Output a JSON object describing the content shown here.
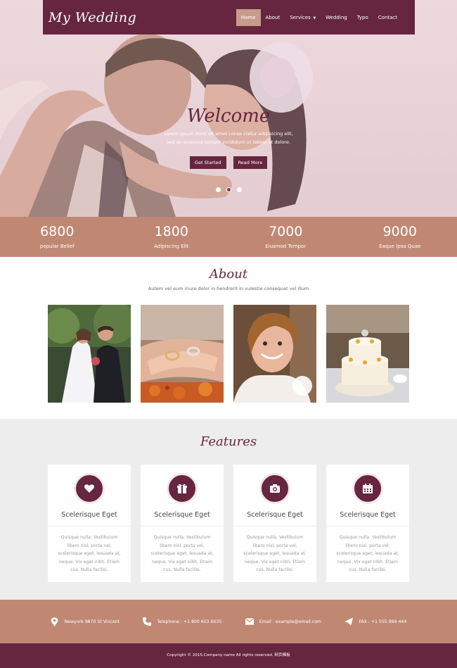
{
  "brand": {
    "logo": "My Wedding",
    "accent": "#66263f",
    "secondary": "#c08873"
  },
  "nav": {
    "items": [
      {
        "label": "Home",
        "active": true
      },
      {
        "label": "About"
      },
      {
        "label": "Services"
      },
      {
        "label": "Wedding"
      },
      {
        "label": "Typo"
      },
      {
        "label": "Contact"
      }
    ]
  },
  "hero": {
    "title": "Welcome",
    "text": "Lorem ipsum dolor sit amet conse ctetur adipisicing elit, sed do eiusmod tempor incididunt ut labore et dolore.",
    "primary_button": "Get Started",
    "secondary_button": "Read More",
    "slides": 3,
    "active_slide": 2
  },
  "stats": [
    {
      "value": "6800",
      "label": "popular Belief"
    },
    {
      "value": "1800",
      "label": "Adipiscing Elit"
    },
    {
      "value": "7000",
      "label": "Eiusmod Tempor"
    },
    {
      "value": "9000",
      "label": "Eaque Ipsa Quae"
    }
  ],
  "about": {
    "title": "About",
    "subtitle": "Autem vel eum iriure dolor in hendrerit in vulestie consequat vel illum"
  },
  "features": {
    "title": "Features",
    "cards": [
      {
        "icon": "heart-icon",
        "title": "Scelerisque Eget",
        "text": "Quisque nulla. Vestibulum libero nisl, porta vel, scelerisque eget, lesuada at, neque. Vix eget nibh. Etiam cus. Nulla facilisi."
      },
      {
        "icon": "gift-icon",
        "title": "Scelerisque Eget",
        "text": "Quisque nulla. Vestibulum libero nisl, porta vel, scelerisque eget, lesuada at, neque. Vix eget nibh. Etiam cus. Nulla facilisi."
      },
      {
        "icon": "camera-icon",
        "title": "Scelerisque Eget",
        "text": "Quisque nulla. Vestibulum libero nisl, porta vel, scelerisque eget, lesuada at, neque. Vix eget nibh. Etiam cus. Nulla facilisi."
      },
      {
        "icon": "calendar-icon",
        "title": "Scelerisque Eget",
        "text": "Quisque nulla. Vestibulum libero nisl, porta vel, scelerisque eget, lesuada at, neque. Vix eget nibh. Etiam cus. Nulla facilisi."
      }
    ]
  },
  "contact": {
    "address": "Newyork 9870 St Vincent",
    "telephone": "Telephone : +1 800 603 6035",
    "email": "Email : example@email.com",
    "fax": "FAX : +1 555 999 444"
  },
  "footer": {
    "copyright": "Copyright © 2015.Company name All rights reserved. 网页模板"
  }
}
